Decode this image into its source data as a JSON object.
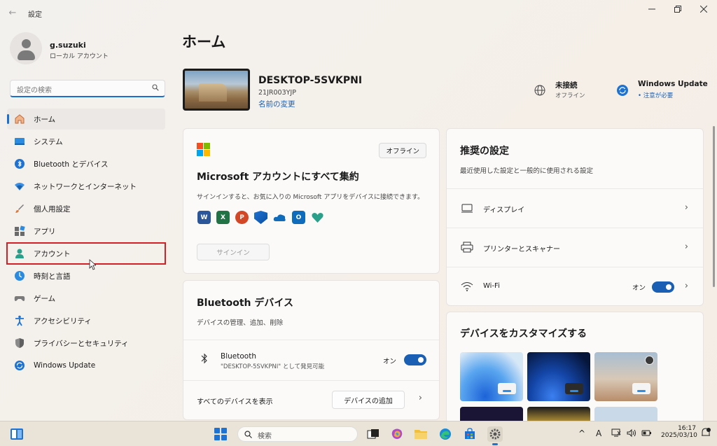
{
  "window": {
    "title": "設定"
  },
  "user": {
    "name": "g.suzuki",
    "account_type": "ローカル アカウント"
  },
  "search": {
    "placeholder": "設定の検索"
  },
  "nav": {
    "items": [
      {
        "label": "ホーム",
        "icon": "home-icon"
      },
      {
        "label": "システム",
        "icon": "system-icon"
      },
      {
        "label": "Bluetooth とデバイス",
        "icon": "bluetooth-icon"
      },
      {
        "label": "ネットワークとインターネット",
        "icon": "network-icon"
      },
      {
        "label": "個人用設定",
        "icon": "brush-icon"
      },
      {
        "label": "アプリ",
        "icon": "apps-icon"
      },
      {
        "label": "アカウント",
        "icon": "account-icon"
      },
      {
        "label": "時刻と言語",
        "icon": "time-language-icon"
      },
      {
        "label": "ゲーム",
        "icon": "gamepad-icon"
      },
      {
        "label": "アクセシビリティ",
        "icon": "accessibility-icon"
      },
      {
        "label": "プライバシーとセキュリティ",
        "icon": "shield-icon"
      },
      {
        "label": "Windows Update",
        "icon": "windows-update-icon"
      }
    ]
  },
  "main": {
    "title": "ホーム",
    "device": {
      "name": "DESKTOP-5SVKPNI",
      "model": "21JR003YJP",
      "rename_label": "名前の変更"
    },
    "status": {
      "network": {
        "title": "未接続",
        "sub": "オフライン"
      },
      "update": {
        "title": "Windows Update",
        "sub": "• 注意が必要"
      }
    },
    "ms_account": {
      "badge": "オフライン",
      "title": "Microsoft アカウントにすべて集約",
      "description": "サインインすると、お気に入りの Microsoft アプリをデバイスに接続できます。",
      "signin_label": "サインイン",
      "apps": [
        "W",
        "X",
        "P",
        "",
        "",
        "O",
        ""
      ]
    },
    "bluetooth": {
      "title": "Bluetooth デバイス",
      "subtitle": "デバイスの管理、追加、削除",
      "device_name": "Bluetooth",
      "device_desc": "\"DESKTOP-5SVKPNI\" として発見可能",
      "state_label": "オン",
      "show_all_label": "すべてのデバイスを表示",
      "add_label": "デバイスの追加"
    },
    "recommended": {
      "title": "推奨の設定",
      "subtitle": "最近使用した設定と一般的に使用される設定",
      "items": [
        {
          "label": "ディスプレイ",
          "icon": "display-icon"
        },
        {
          "label": "プリンターとスキャナー",
          "icon": "printer-icon"
        },
        {
          "label": "Wi-Fi",
          "icon": "wifi-icon",
          "state": "オン"
        }
      ]
    },
    "customize": {
      "title": "デバイスをカスタマイズする"
    }
  },
  "taskbar": {
    "search_placeholder": "検索",
    "time": "16:17",
    "date": "2025/03/10",
    "ime": "A"
  },
  "colors": {
    "accent": "#1a5fb4",
    "highlight_box": "#d41f26"
  }
}
